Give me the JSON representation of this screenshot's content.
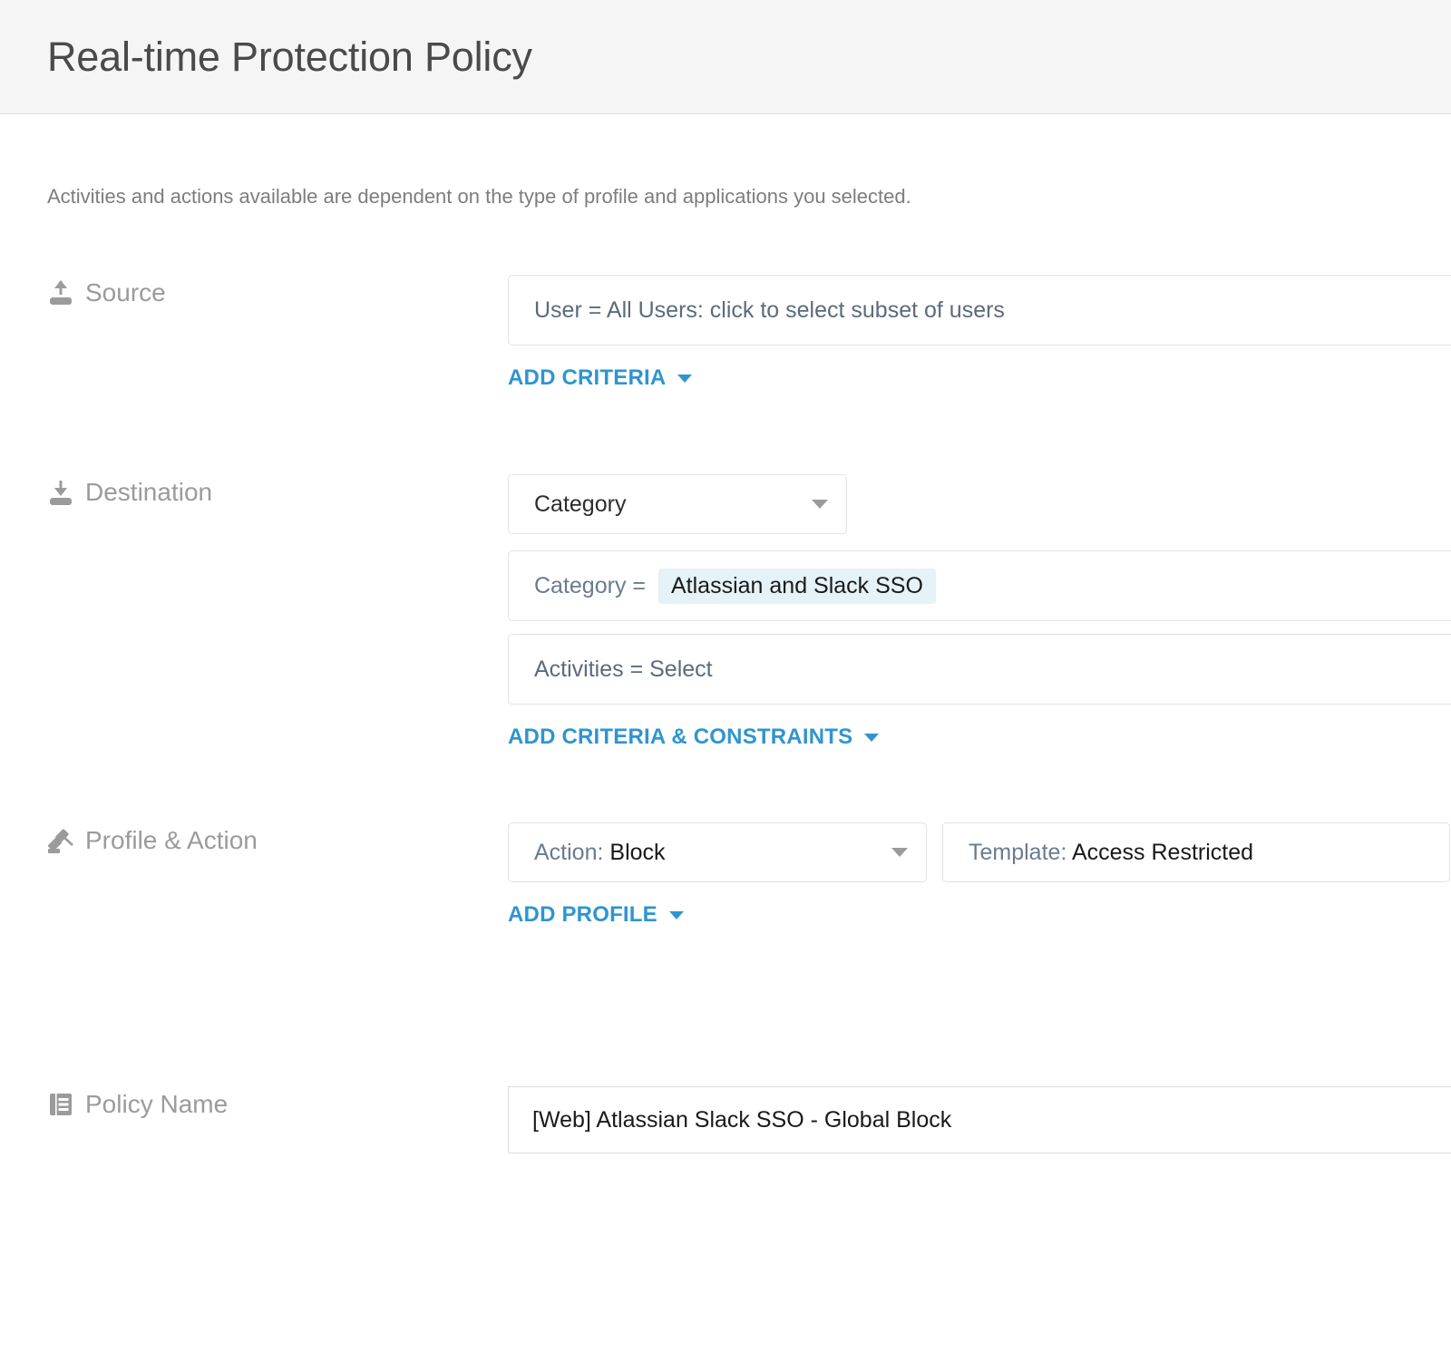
{
  "header": {
    "title": "Real-time Protection Policy"
  },
  "intro": {
    "text": "Activities and actions available are dependent on the type of profile and applications you selected."
  },
  "colors": {
    "link": "#2f95cf",
    "chip_background": "#e5f2f8",
    "label": "#9b9b9b",
    "header_background": "#f5f5f5"
  },
  "sections": {
    "source": {
      "label": "Source",
      "icon": "upload-icon",
      "criteria_value": "User = All Users: click to select subset of users",
      "add_link": "ADD CRITERIA"
    },
    "destination": {
      "label": "Destination",
      "icon": "download-icon",
      "type_select": "Category",
      "criteria_key": "Category =",
      "criteria_chip": "Atlassian and Slack SSO",
      "activities_value": "Activities = Select",
      "add_link": "ADD CRITERIA & CONSTRAINTS"
    },
    "profile_action": {
      "label": "Profile & Action",
      "icon": "gavel-icon",
      "action_prefix": "Action:",
      "action_value": "Block",
      "template_prefix": "Template:",
      "template_value": "Access Restricted",
      "add_link": "ADD PROFILE"
    },
    "policy_name": {
      "label": "Policy Name",
      "icon": "document-lines-icon",
      "value": "[Web] Atlassian Slack SSO - Global Block"
    }
  }
}
